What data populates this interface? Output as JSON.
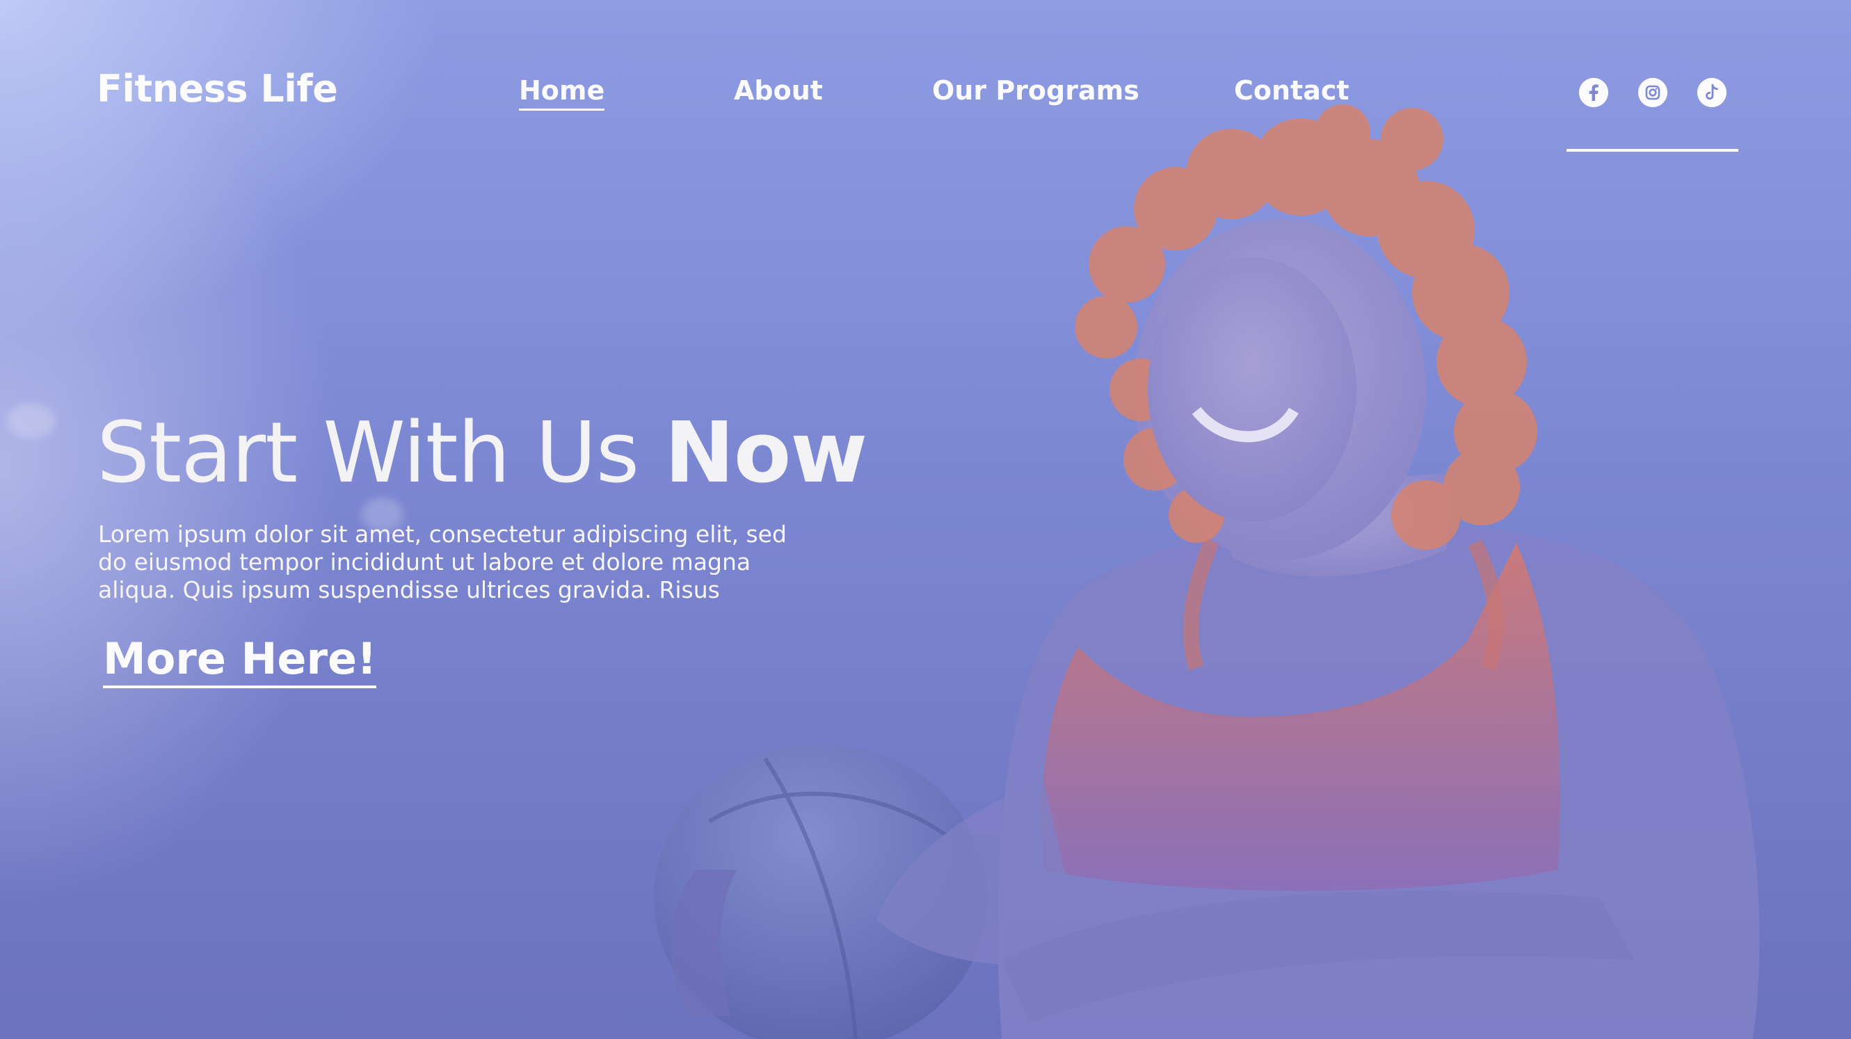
{
  "brand": {
    "name": "Fitness Life"
  },
  "nav": {
    "items": [
      {
        "label": "Home",
        "active": true
      },
      {
        "label": "About",
        "active": false
      },
      {
        "label": "Our Programs",
        "active": false
      },
      {
        "label": "Contact",
        "active": false
      }
    ]
  },
  "social": {
    "icons": [
      "facebook-icon",
      "instagram-icon",
      "tiktok-icon"
    ]
  },
  "hero": {
    "title_regular": "Start With Us ",
    "title_bold": "Now",
    "body_lines": [
      "Lorem ipsum dolor sit amet, consectetur adipiscing elit, sed",
      "do eiusmod tempor incididunt ut labore et dolore magna",
      "aliqua. Quis ipsum suspendisse ultrices gravida. Risus"
    ],
    "cta_label": "More Here!"
  },
  "colors": {
    "background": "#7c87d2",
    "text": "#f6f6f8",
    "accent_top_left": "#c8d2fa",
    "hair": "#d9806f",
    "top": "#d7796d"
  }
}
